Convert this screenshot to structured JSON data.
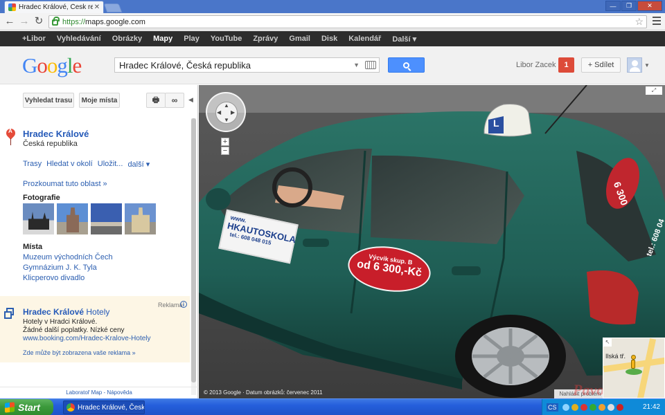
{
  "browser": {
    "tab_title": "Hradec Králové, Česk republi",
    "url_scheme": "https://",
    "url_rest": "maps.google.com"
  },
  "gbar": {
    "items": [
      "+Libor",
      "Vyhledávání",
      "Obrázky",
      "Mapy",
      "Play",
      "YouTube",
      "Zprávy",
      "Gmail",
      "Disk",
      "Kalendář",
      "Další ▾"
    ],
    "active": "Mapy"
  },
  "header": {
    "logo": "Google",
    "search_value": "Hradec Králové, Česká republika",
    "user_name": "Libor Zacek",
    "notification_count": "1",
    "share_label": "+ Sdílet"
  },
  "left_panel": {
    "btn_route": "Vyhledat trasu",
    "btn_my_places": "Moje místa",
    "place_marker": "A",
    "place_name": "Hradec Králové",
    "place_country": "Česká republika",
    "actions": [
      "Trasy",
      "Hledat v okolí",
      "Uložit...",
      "další ▾"
    ],
    "explore": "Prozkoumat tuto oblast »",
    "photos_heading": "Fotografie",
    "places_heading": "Místa",
    "places": [
      "Muzeum východních Čech",
      "Gymnázium J. K. Tyla",
      "Klicperovo divadlo"
    ],
    "ad": {
      "label": "Reklama",
      "title_bold": "Hradec Králové",
      "title_rest": " Hotely",
      "line1": "Hotely v Hradci Králové.",
      "line2": "Žádné další poplatky. Nízké ceny",
      "url": "www.booking.com/Hradec-Kralove-Hotely",
      "where": "Zde může být zobrazena vaše reklama »"
    },
    "footer": "Laboratoř Map - Nápověda"
  },
  "street_view": {
    "copyright": "© 2013 Google · Datum obrázků: červenec 2011",
    "report": "Nahlásit problém",
    "sign_text_1": "www.",
    "sign_text_2": "HKAUTOSKOLA",
    "sign_text_3": "tel.: 608 048 015",
    "oval_text_1": "Výcvik skup. B",
    "oval_text_2": "od 6 300,-Kč",
    "roof_sign": "L",
    "minimap_label": "Ilská tř."
  },
  "taskbar": {
    "start": "Start",
    "task_item": "Hradec Králové, Česk...",
    "lang": "CS",
    "clock": "21:42"
  },
  "colors": {
    "car_green": "#1f5e55",
    "google_blue": "#4d90fe",
    "notif_red": "#dd4b39",
    "link_blue": "#2a5db0"
  }
}
